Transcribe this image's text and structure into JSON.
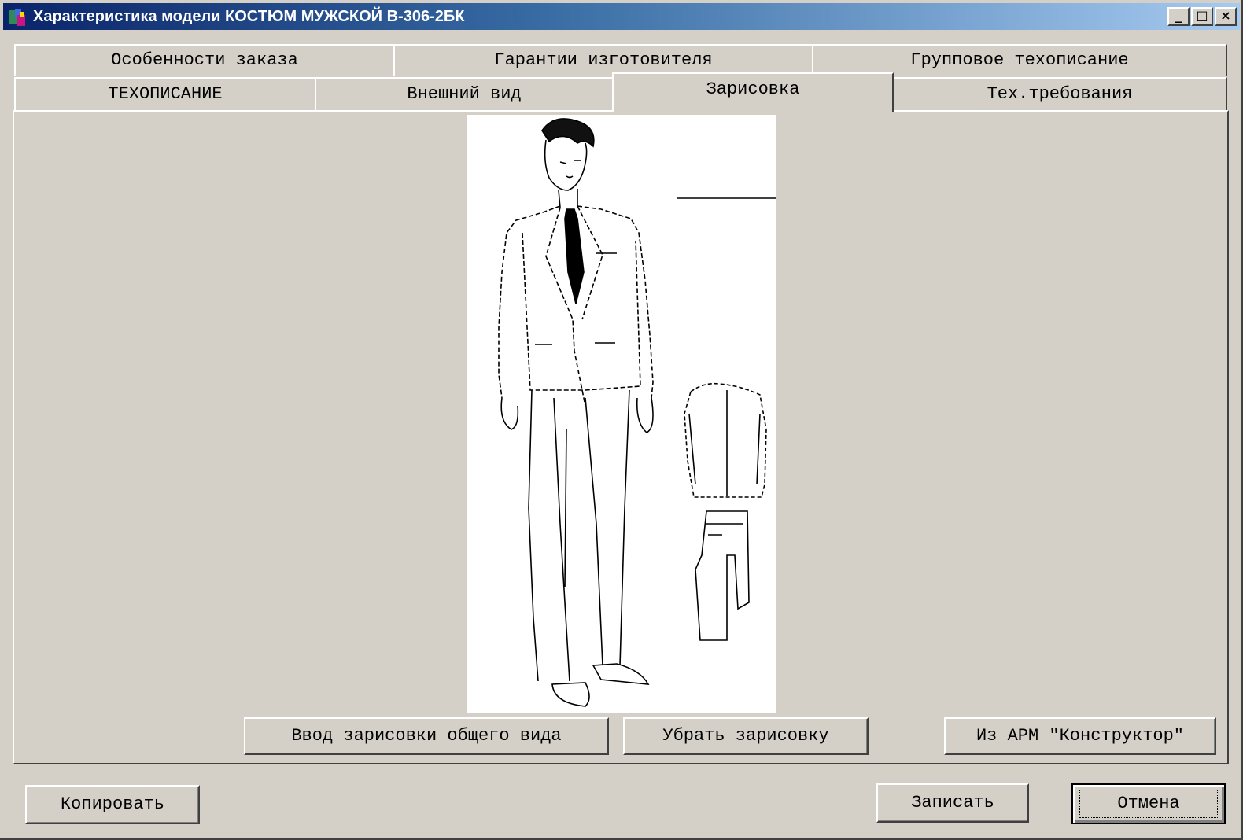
{
  "window": {
    "title": "Характеристика модели КОСТЮМ МУЖСКОЙ В-306-2БК",
    "controls": {
      "minimize": "_",
      "maximize": "□",
      "close": "×"
    }
  },
  "tabs": {
    "row1": [
      {
        "label": "Особенности заказа"
      },
      {
        "label": "Гарантии изготовителя"
      },
      {
        "label": "Групповое техописание"
      }
    ],
    "row2": [
      {
        "label": "ТЕХОПИСАНИЕ"
      },
      {
        "label": "Внешний вид"
      },
      {
        "label": "Зарисовка",
        "active": true
      },
      {
        "label": "Тех.требования"
      }
    ]
  },
  "sketch_panel": {
    "buttons": {
      "input_sketch": "Ввод зарисовки общего вида",
      "remove_sketch": "Убрать зарисовку",
      "from_arm": "Из АРМ \"Конструктор\""
    }
  },
  "footer": {
    "copy": "Копировать",
    "save": "Записать",
    "cancel": "Отмена"
  },
  "colors": {
    "window_bg": "#d4d0c8",
    "titlebar_start": "#0a246a",
    "titlebar_end": "#a6caf0"
  }
}
